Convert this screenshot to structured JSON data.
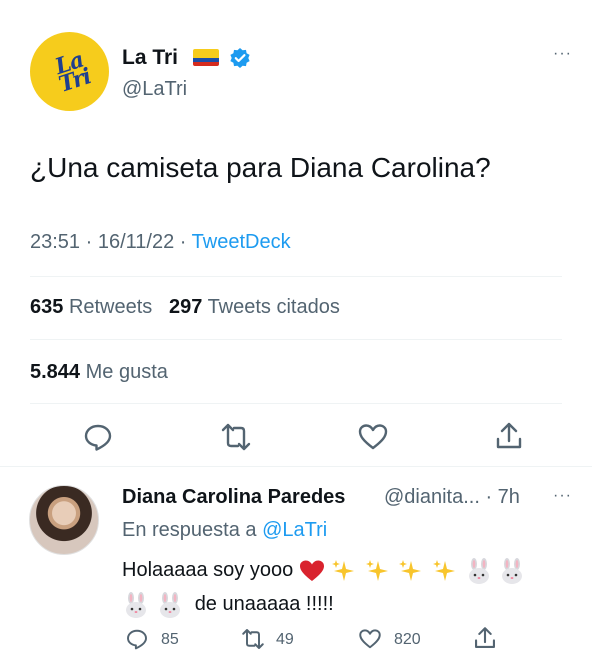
{
  "tweet": {
    "avatar_logo_text": "La Tri",
    "display_name": "La Tri",
    "handle": "@LaTri",
    "text": "¿Una camiseta para Diana Carolina?",
    "time": "23:51",
    "date": "16/11/22",
    "source": "TweetDeck",
    "retweets_count": "635",
    "retweets_label": "Retweets",
    "quotes_count": "297",
    "quotes_label": "Tweets citados",
    "likes_count": "5.844",
    "likes_label": "Me gusta",
    "flag_colors": [
      "#f6cc1c",
      "#1a4ea8",
      "#d52b1e"
    ],
    "verified_color": "#1d9bf0",
    "more_label": "···"
  },
  "reply": {
    "display_name": "Diana Carolina Paredes",
    "handle_and_time": "@dianita... · 7h",
    "in_reply_prefix": "En respuesta a",
    "in_reply_mention": "@LaTri",
    "text_line1": "Holaaaaa soy yooo",
    "text_line2": "de unaaaaa !!!!!",
    "line1_emojis": [
      "heart",
      "sparkles",
      "sparkles",
      "sparkles",
      "sparkles",
      "rabbit",
      "rabbit"
    ],
    "line2_emojis": [
      "rabbit",
      "rabbit"
    ],
    "reply_count": "85",
    "retweet_count": "49",
    "like_count": "820",
    "more_label": "···"
  },
  "colors": {
    "accent": "#1d9bf0",
    "text_primary": "#0f1419",
    "text_secondary": "#536471",
    "divider": "#eff3f4",
    "heart_emoji": "#d9232e",
    "sparkle_emoji": "#f8c52c"
  },
  "icons": {
    "reply": "reply-icon",
    "retweet": "retweet-icon",
    "like": "like-icon",
    "share": "share-icon",
    "verified": "verified-badge-icon"
  }
}
